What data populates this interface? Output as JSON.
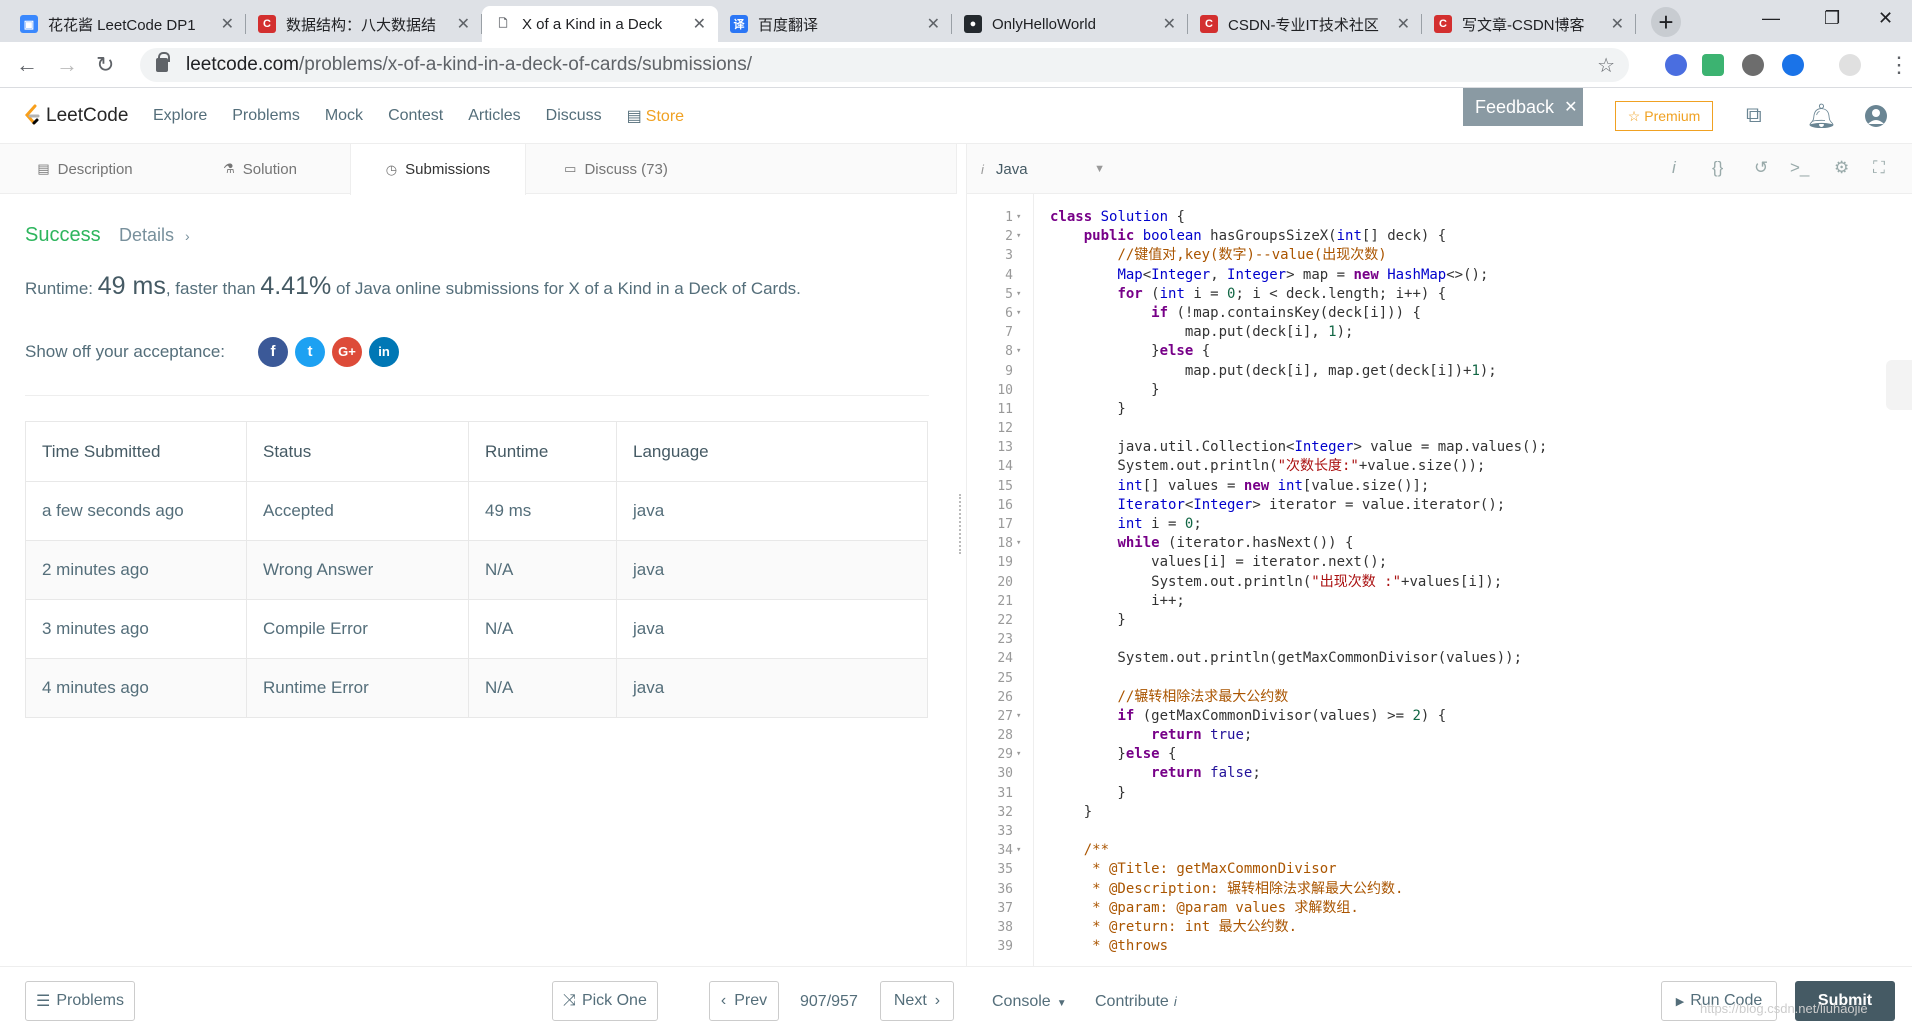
{
  "browser": {
    "tabs": [
      {
        "title": "花花酱 LeetCode DP1",
        "color": "#3a88fd",
        "glyph": "▣",
        "active": false
      },
      {
        "title": "数据结构：八大数据结",
        "color": "#d32f2f",
        "glyph": "C",
        "active": false
      },
      {
        "title": "X of a Kind in a Deck",
        "color": "#ffffff",
        "glyph": "🗋",
        "active": true
      },
      {
        "title": "百度翻译",
        "color": "#2b76f5",
        "glyph": "译",
        "active": false
      },
      {
        "title": "OnlyHelloWorld",
        "color": "#24292e",
        "glyph": "●",
        "active": false
      },
      {
        "title": "CSDN-专业IT技术社区",
        "color": "#d32f2f",
        "glyph": "C",
        "active": false
      },
      {
        "title": "写文章-CSDN博客",
        "color": "#d32f2f",
        "glyph": "C",
        "active": false
      }
    ],
    "url_host": "leetcode.com",
    "url_path": "/problems/x-of-a-kind-in-a-deck-of-cards/submissions/"
  },
  "nav": {
    "logo": "LeetCode",
    "links": [
      "Explore",
      "Problems",
      "Mock",
      "Contest",
      "Articles",
      "Discuss"
    ],
    "store": "Store",
    "feedback": "Feedback",
    "premium": "Premium"
  },
  "left_tabs": [
    {
      "label": "Description",
      "icon": "document-icon"
    },
    {
      "label": "Solution",
      "icon": "flask-icon"
    },
    {
      "label": "Submissions",
      "icon": "clock-icon"
    },
    {
      "label": "Discuss (73)",
      "icon": "comment-icon"
    }
  ],
  "result": {
    "status": "Success",
    "details": "Details",
    "runtime_label": "Runtime:",
    "runtime_value": "49 ms",
    "faster_label": ", faster than",
    "faster_value": "4.41%",
    "faster_suffix": "of Java online submissions for X of a Kind in a Deck of Cards.",
    "showoff": "Show off your acceptance:"
  },
  "social": [
    {
      "name": "facebook-icon",
      "glyph": "f",
      "color": "#3b5998"
    },
    {
      "name": "twitter-icon",
      "glyph": "t",
      "color": "#1da1f2"
    },
    {
      "name": "google-plus-icon",
      "glyph": "G+",
      "color": "#dd4b39"
    },
    {
      "name": "linkedin-icon",
      "glyph": "in",
      "color": "#0077b5"
    }
  ],
  "table": {
    "headers": [
      "Time Submitted",
      "Status",
      "Runtime",
      "Language"
    ],
    "rows": [
      {
        "time": "a few seconds ago",
        "status": "Accepted",
        "ok": true,
        "runtime": "49 ms",
        "lang": "java"
      },
      {
        "time": "2 minutes ago",
        "status": "Wrong Answer",
        "ok": false,
        "runtime": "N/A",
        "lang": "java"
      },
      {
        "time": "3 minutes ago",
        "status": "Compile Error",
        "ok": false,
        "runtime": "N/A",
        "lang": "java"
      },
      {
        "time": "4 minutes ago",
        "status": "Runtime Error",
        "ok": false,
        "runtime": "N/A",
        "lang": "java"
      }
    ]
  },
  "editor": {
    "language": "Java",
    "lines": [
      {
        "n": 1,
        "fold": true,
        "code": "class Solution {"
      },
      {
        "n": 2,
        "fold": true,
        "code": "    public boolean hasGroupsSizeX(int[] deck) {"
      },
      {
        "n": 3,
        "fold": false,
        "code": "        //键值对,key(数字)--value(出现次数)"
      },
      {
        "n": 4,
        "fold": false,
        "code": "        Map<Integer, Integer> map = new HashMap<>();"
      },
      {
        "n": 5,
        "fold": true,
        "code": "        for (int i = 0; i < deck.length; i++) {"
      },
      {
        "n": 6,
        "fold": true,
        "code": "            if (!map.containsKey(deck[i])) {"
      },
      {
        "n": 7,
        "fold": false,
        "code": "                map.put(deck[i], 1);"
      },
      {
        "n": 8,
        "fold": true,
        "code": "            }else {"
      },
      {
        "n": 9,
        "fold": false,
        "code": "                map.put(deck[i], map.get(deck[i])+1);"
      },
      {
        "n": 10,
        "fold": false,
        "code": "            }"
      },
      {
        "n": 11,
        "fold": false,
        "code": "        }"
      },
      {
        "n": 12,
        "fold": false,
        "code": ""
      },
      {
        "n": 13,
        "fold": false,
        "code": "        java.util.Collection<Integer> value = map.values();"
      },
      {
        "n": 14,
        "fold": false,
        "code": "        System.out.println(\"次数长度:\"+value.size());"
      },
      {
        "n": 15,
        "fold": false,
        "code": "        int[] values = new int[value.size()];"
      },
      {
        "n": 16,
        "fold": false,
        "code": "        Iterator<Integer> iterator = value.iterator();"
      },
      {
        "n": 17,
        "fold": false,
        "code": "        int i = 0;"
      },
      {
        "n": 18,
        "fold": true,
        "code": "        while (iterator.hasNext()) {"
      },
      {
        "n": 19,
        "fold": false,
        "code": "            values[i] = iterator.next();"
      },
      {
        "n": 20,
        "fold": false,
        "code": "            System.out.println(\"出现次数 :\"+values[i]);"
      },
      {
        "n": 21,
        "fold": false,
        "code": "            i++;"
      },
      {
        "n": 22,
        "fold": false,
        "code": "        }"
      },
      {
        "n": 23,
        "fold": false,
        "code": ""
      },
      {
        "n": 24,
        "fold": false,
        "code": "        System.out.println(getMaxCommonDivisor(values));"
      },
      {
        "n": 25,
        "fold": false,
        "code": ""
      },
      {
        "n": 26,
        "fold": false,
        "code": "        //辗转相除法求最大公约数"
      },
      {
        "n": 27,
        "fold": true,
        "code": "        if (getMaxCommonDivisor(values) >= 2) {"
      },
      {
        "n": 28,
        "fold": false,
        "code": "            return true;"
      },
      {
        "n": 29,
        "fold": true,
        "code": "        }else {"
      },
      {
        "n": 30,
        "fold": false,
        "code": "            return false;"
      },
      {
        "n": 31,
        "fold": false,
        "code": "        }"
      },
      {
        "n": 32,
        "fold": false,
        "code": "    }"
      },
      {
        "n": 33,
        "fold": false,
        "code": ""
      },
      {
        "n": 34,
        "fold": true,
        "code": "    /**"
      },
      {
        "n": 35,
        "fold": false,
        "code": "     * @Title: getMaxCommonDivisor"
      },
      {
        "n": 36,
        "fold": false,
        "code": "     * @Description: 辗转相除法求解最大公约数."
      },
      {
        "n": 37,
        "fold": false,
        "code": "     * @param: @param values 求解数组."
      },
      {
        "n": 38,
        "fold": false,
        "code": "     * @return: int 最大公约数."
      },
      {
        "n": 39,
        "fold": false,
        "code": "     * @throws"
      }
    ]
  },
  "bottom": {
    "problems": "Problems",
    "pick_one": "Pick One",
    "prev": "Prev",
    "counter": "907/957",
    "next": "Next",
    "console": "Console",
    "contribute": "Contribute",
    "run_code": "Run Code",
    "submit": "Submit",
    "watermark": "https://blog.csdn.net/liuhaojie"
  },
  "colors": {
    "success": "#2db55d",
    "error": "#d93838",
    "store": "#f0a122"
  }
}
